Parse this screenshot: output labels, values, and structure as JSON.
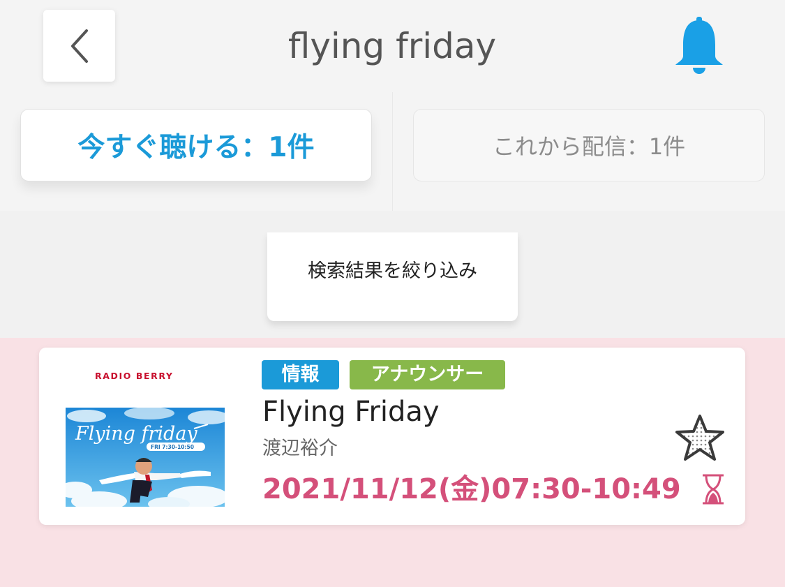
{
  "header": {
    "title": "flying friday",
    "back_icon": "chevron-left-icon",
    "bell_icon": "bell-icon"
  },
  "tabs": [
    {
      "label": "今すぐ聴ける：1件",
      "active": true
    },
    {
      "label": "これから配信：1件",
      "active": false
    }
  ],
  "filter": {
    "label": "検索結果を絞り込み"
  },
  "program": {
    "station_logo": "RADIO BERRY",
    "thumbnail_text": "Flying friday",
    "thumbnail_time": "FRI 7:30-10:50",
    "tags": [
      {
        "label": "情報",
        "color": "#1b9ad8"
      },
      {
        "label": "アナウンサー",
        "color": "#88b84a"
      }
    ],
    "title": "Flying Friday",
    "performer": "渡辺裕介",
    "broadcast_time": "2021/11/12(金)07:30-10:49",
    "favorite_icon": "star-icon",
    "timefree_icon": "hourglass-icon"
  },
  "colors": {
    "accent_blue": "#1b9ad8",
    "time_pink": "#d4507a",
    "results_background": "#f9e1e5"
  }
}
